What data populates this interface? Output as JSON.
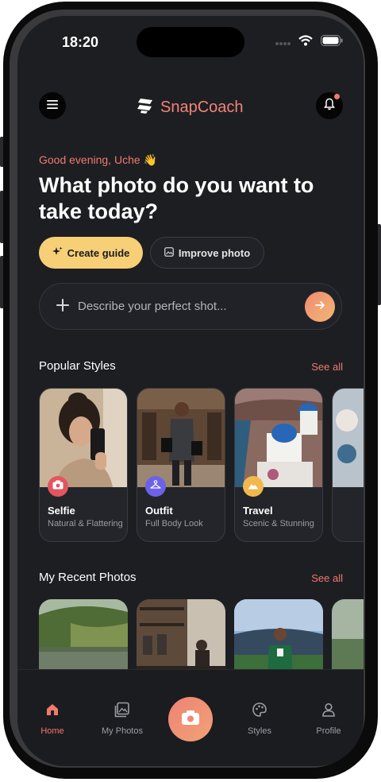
{
  "status_bar": {
    "time": "18:20"
  },
  "header": {
    "brand": "SnapCoach"
  },
  "greeting": "Good evening, Uche 👋",
  "headline": "What photo do you want to take today?",
  "actions": {
    "create_label": "Create guide",
    "improve_label": "Improve photo"
  },
  "prompt": {
    "placeholder": "Describe your perfect shot..."
  },
  "popular": {
    "title": "Popular Styles",
    "see_all": "See all",
    "styles": [
      {
        "title": "Selfie",
        "subtitle": "Natural & Flattering",
        "badge_color": "#e4555f",
        "icon": "camera-icon"
      },
      {
        "title": "Outfit",
        "subtitle": "Full Body Look",
        "badge_color": "#6c62e8",
        "icon": "hanger-icon"
      },
      {
        "title": "Travel",
        "subtitle": "Scenic & Stunning",
        "badge_color": "#f2b84e",
        "icon": "mountain-icon"
      }
    ]
  },
  "recent": {
    "title": "My Recent Photos",
    "see_all": "See all"
  },
  "tabs": {
    "home": "Home",
    "photos": "My Photos",
    "styles": "Styles",
    "profile": "Profile"
  },
  "colors": {
    "accent": "#f07a6f",
    "create_button": "#f6cf77",
    "background": "#1d1e22"
  }
}
